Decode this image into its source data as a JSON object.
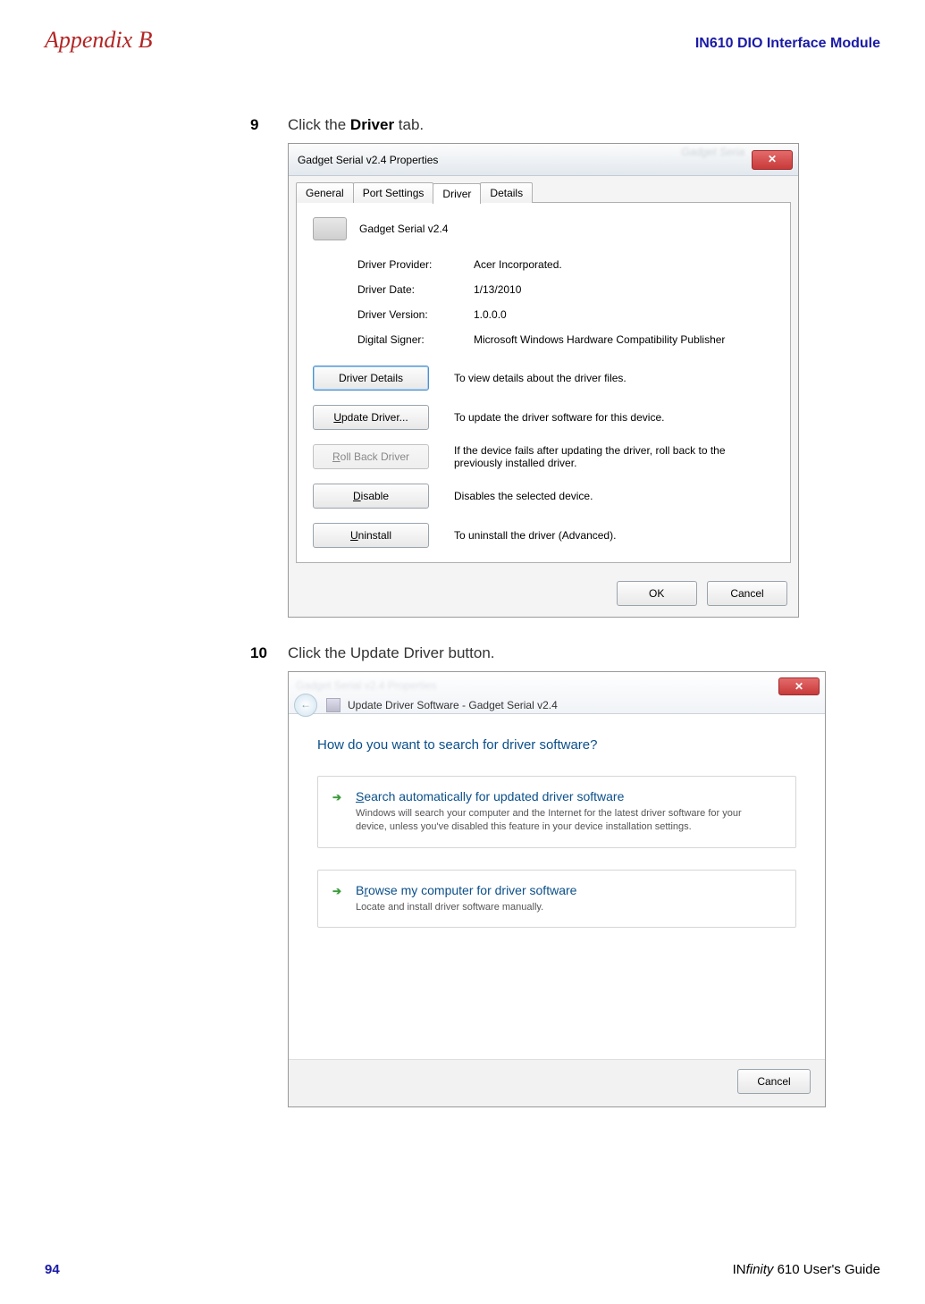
{
  "header": {
    "left": "Appendix B",
    "right": "IN610 DIO Interface Module"
  },
  "steps": {
    "s9": {
      "num": "9",
      "text_pre": "Click the ",
      "text_bold": "Driver",
      "text_post": " tab."
    },
    "s10": {
      "num": "10",
      "text": "Click the Update Driver button."
    }
  },
  "dlg": {
    "title": "Gadget Serial v2.4 Properties",
    "tabs": {
      "general": "General",
      "port_settings": "Port Settings",
      "driver": "Driver",
      "details": "Details"
    },
    "device_name": "Gadget Serial v2.4",
    "fields": {
      "provider_k": "Driver Provider:",
      "provider_v": "Acer Incorporated.",
      "date_k": "Driver Date:",
      "date_v": "1/13/2010",
      "version_k": "Driver Version:",
      "version_v": "1.0.0.0",
      "signer_k": "Digital Signer:",
      "signer_v": "Microsoft Windows Hardware Compatibility Publisher"
    },
    "buttons": {
      "details": "Driver Details",
      "details_desc": "To view details about the driver files.",
      "update": "Update Driver...",
      "update_desc": "To update the driver software for this device.",
      "rollback": "Roll Back Driver",
      "rollback_desc": "If the device fails after updating the driver, roll back to the previously installed driver.",
      "disable": "Disable",
      "disable_desc": "Disables the selected device.",
      "uninstall": "Uninstall",
      "uninstall_desc": "To uninstall the driver (Advanced).",
      "ok": "OK",
      "cancel": "Cancel"
    }
  },
  "wiz": {
    "title": "Update Driver Software - Gadget Serial v2.4",
    "question": "How do you want to search for driver software?",
    "opt1": {
      "title": "Search automatically for updated driver software",
      "sub": "Windows will search your computer and the Internet for the latest driver software for your device, unless you've disabled this feature in your device installation settings."
    },
    "opt2": {
      "title": "Browse my computer for driver software",
      "sub": "Locate and install driver software manually."
    },
    "cancel": "Cancel"
  },
  "footer": {
    "page": "94",
    "guide_brand": "IN",
    "guide_italic": "finity",
    "guide_rest": " 610 User's Guide"
  }
}
